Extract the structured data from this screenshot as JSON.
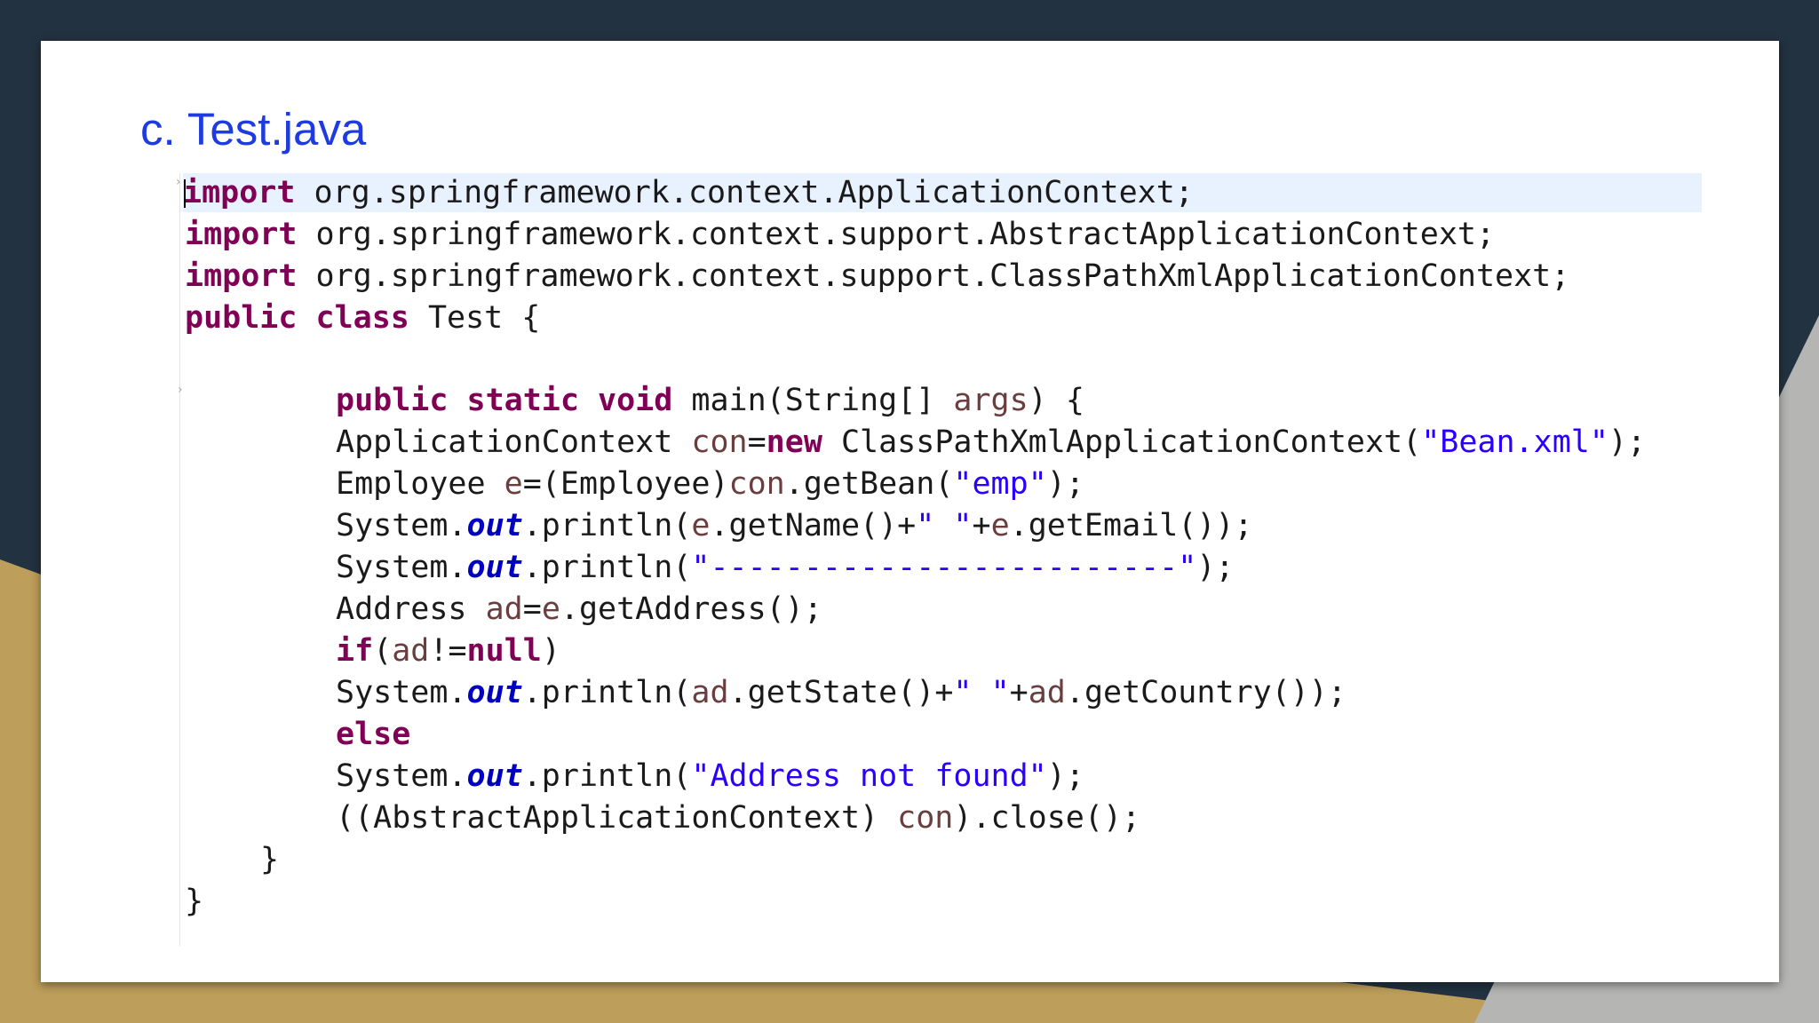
{
  "slide": {
    "title": "c. Test.java",
    "code_language": "java",
    "code_lines": [
      "import org.springframework.context.ApplicationContext;",
      "import org.springframework.context.support.AbstractApplicationContext;",
      "import org.springframework.context.support.ClassPathXmlApplicationContext;",
      "public class Test {",
      "",
      "public static void main(String[] args) {",
      "ApplicationContext con=new ClassPathXmlApplicationContext(\"Bean.xml\");",
      "Employee e=(Employee)con.getBean(\"emp\");",
      "System.out.println(e.getName()+\" \"+e.getEmail());",
      "System.out.println(\"-------------------------\");",
      "Address ad=e.getAddress();",
      "if(ad!=null)",
      "System.out.println(ad.getState()+\" \"+ad.getCountry());",
      "else",
      "System.out.println(\"Address not found\");",
      "((AbstractApplicationContext) con).close();",
      "}",
      "}"
    ],
    "tokens": {
      "kw_import": "import",
      "kw_public": "public",
      "kw_class": "class",
      "kw_static": "static",
      "kw_void": "void",
      "kw_new": "new",
      "kw_if": "if",
      "kw_null": "null",
      "kw_else": "else",
      "pkg_appctx": " org.springframework.context.ApplicationContext;",
      "pkg_abstract": " org.springframework.context.support.AbstractApplicationContext;",
      "pkg_classpath": " org.springframework.context.support.ClassPathXmlApplicationContext;",
      "class_name": " Test {",
      "main_sig_a": " main(String[] ",
      "args": "args",
      "main_sig_b": ") {",
      "appctx_type": "ApplicationContext ",
      "con": "con",
      "eq": "=",
      "classpath_ctor": " ClassPathXmlApplicationContext(",
      "bean_xml": "\"Bean.xml\"",
      "close_paren_semi": ");",
      "employee_decl": "Employee ",
      "e": "e",
      "employee_cast": "=(Employee)",
      "getbean": ".getBean(",
      "emp_str": "\"emp\"",
      "system": "System.",
      "out": "out",
      "println_open": ".println(",
      "getname": ".getName()+",
      "space_str": "\" \"",
      "plus": "+",
      "getemail": ".getEmail());",
      "dashes_str": "\"-------------------------\"",
      "address_decl": "Address ",
      "ad": "ad",
      "getaddress": ".getAddress();",
      "paren_open": "(",
      "neq": "!=",
      "paren_close": ")",
      "getstate": ".getState()+",
      "getcountry": ".getCountry());",
      "not_found_str": "\"Address not found\"",
      "cast_abstract": "((AbstractApplicationContext) ",
      "close_call": ").close();",
      "brace_close": "}"
    }
  },
  "colors": {
    "title": "#1d3be0",
    "keyword": "#7f0055",
    "string": "#2a00ff",
    "field": "#0000c0",
    "variable": "#6a3e3e",
    "background_dark": "#223240",
    "background_gold": "#bd9e5a",
    "background_gray": "#b5b5b3",
    "current_line_highlight": "#e8f2fe"
  }
}
